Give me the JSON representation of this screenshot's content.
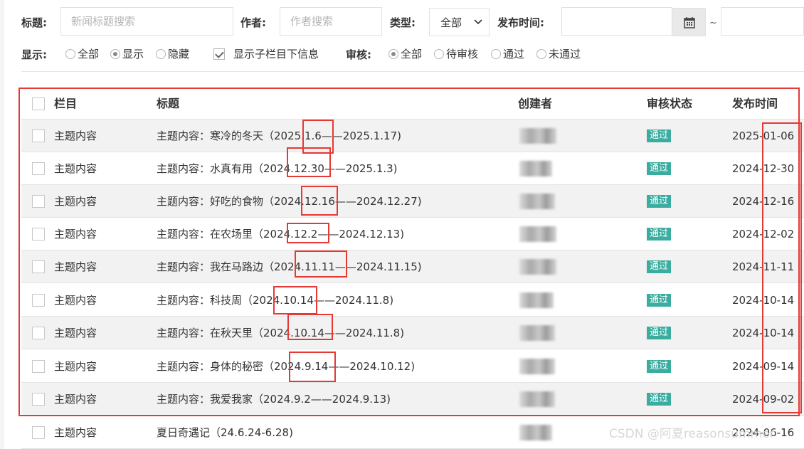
{
  "filters": {
    "title_label": "标题:",
    "title_placeholder": "新闻标题搜索",
    "author_label": "作者:",
    "author_placeholder": "作者搜索",
    "type_label": "类型:",
    "type_value": "全部",
    "date_label": "发布时间:",
    "date_separator": "~",
    "display_label": "显示:",
    "display_options": [
      "全部",
      "显示",
      "隐藏"
    ],
    "display_selected": "显示",
    "subcolumn_label": "显示子栏目下信息",
    "subcolumn_checked": true,
    "review_label": "审核:",
    "review_options": [
      "全部",
      "待审核",
      "通过",
      "未通过"
    ],
    "review_selected": "全部"
  },
  "table": {
    "headers": [
      "栏目",
      "标题",
      "创建者",
      "审核状态",
      "发布时间"
    ],
    "rows": [
      {
        "column": "主题内容",
        "title": "主题内容：寒冷的冬天（2025.1.6——2025.1.17)",
        "status": "通过",
        "date": "2025-01-06"
      },
      {
        "column": "主题内容",
        "title": "主题内容：水真有用（2024.12.30——2025.1.3)",
        "status": "通过",
        "date": "2024-12-30"
      },
      {
        "column": "主题内容",
        "title": "主题内容：好吃的食物（2024.12.16——2024.12.27)",
        "status": "通过",
        "date": "2024-12-16"
      },
      {
        "column": "主题内容",
        "title": "主题内容：在农场里（2024.12.2——2024.12.13)",
        "status": "通过",
        "date": "2024-12-02"
      },
      {
        "column": "主题内容",
        "title": "主题内容：我在马路边（2024.11.11——2024.11.15)",
        "status": "通过",
        "date": "2024-11-11"
      },
      {
        "column": "主题内容",
        "title": "主题内容：科技周（2024.10.14——2024.11.8)",
        "status": "通过",
        "date": "2024-10-14"
      },
      {
        "column": "主题内容",
        "title": "主题内容：在秋天里（2024.10.14——2024.11.8)",
        "status": "通过",
        "date": "2024-10-14"
      },
      {
        "column": "主题内容",
        "title": "主题内容：身体的秘密（2024.9.14——2024.10.12)",
        "status": "通过",
        "date": "2024-09-14"
      },
      {
        "column": "主题内容",
        "title": "主题内容：我爱我家（2024.9.2——2024.9.13)",
        "status": "通过",
        "date": "2024-09-02"
      },
      {
        "column": "主题内容",
        "title": "夏日奇遇记（24.6.24-6.28)",
        "status": "",
        "date": "2024-06-16"
      }
    ]
  },
  "watermark": "CSDN @阿夏reasonsummer",
  "colors": {
    "badge": "#3aada0",
    "highlight": "#e53935",
    "row_alt": "#f2f2f2"
  }
}
